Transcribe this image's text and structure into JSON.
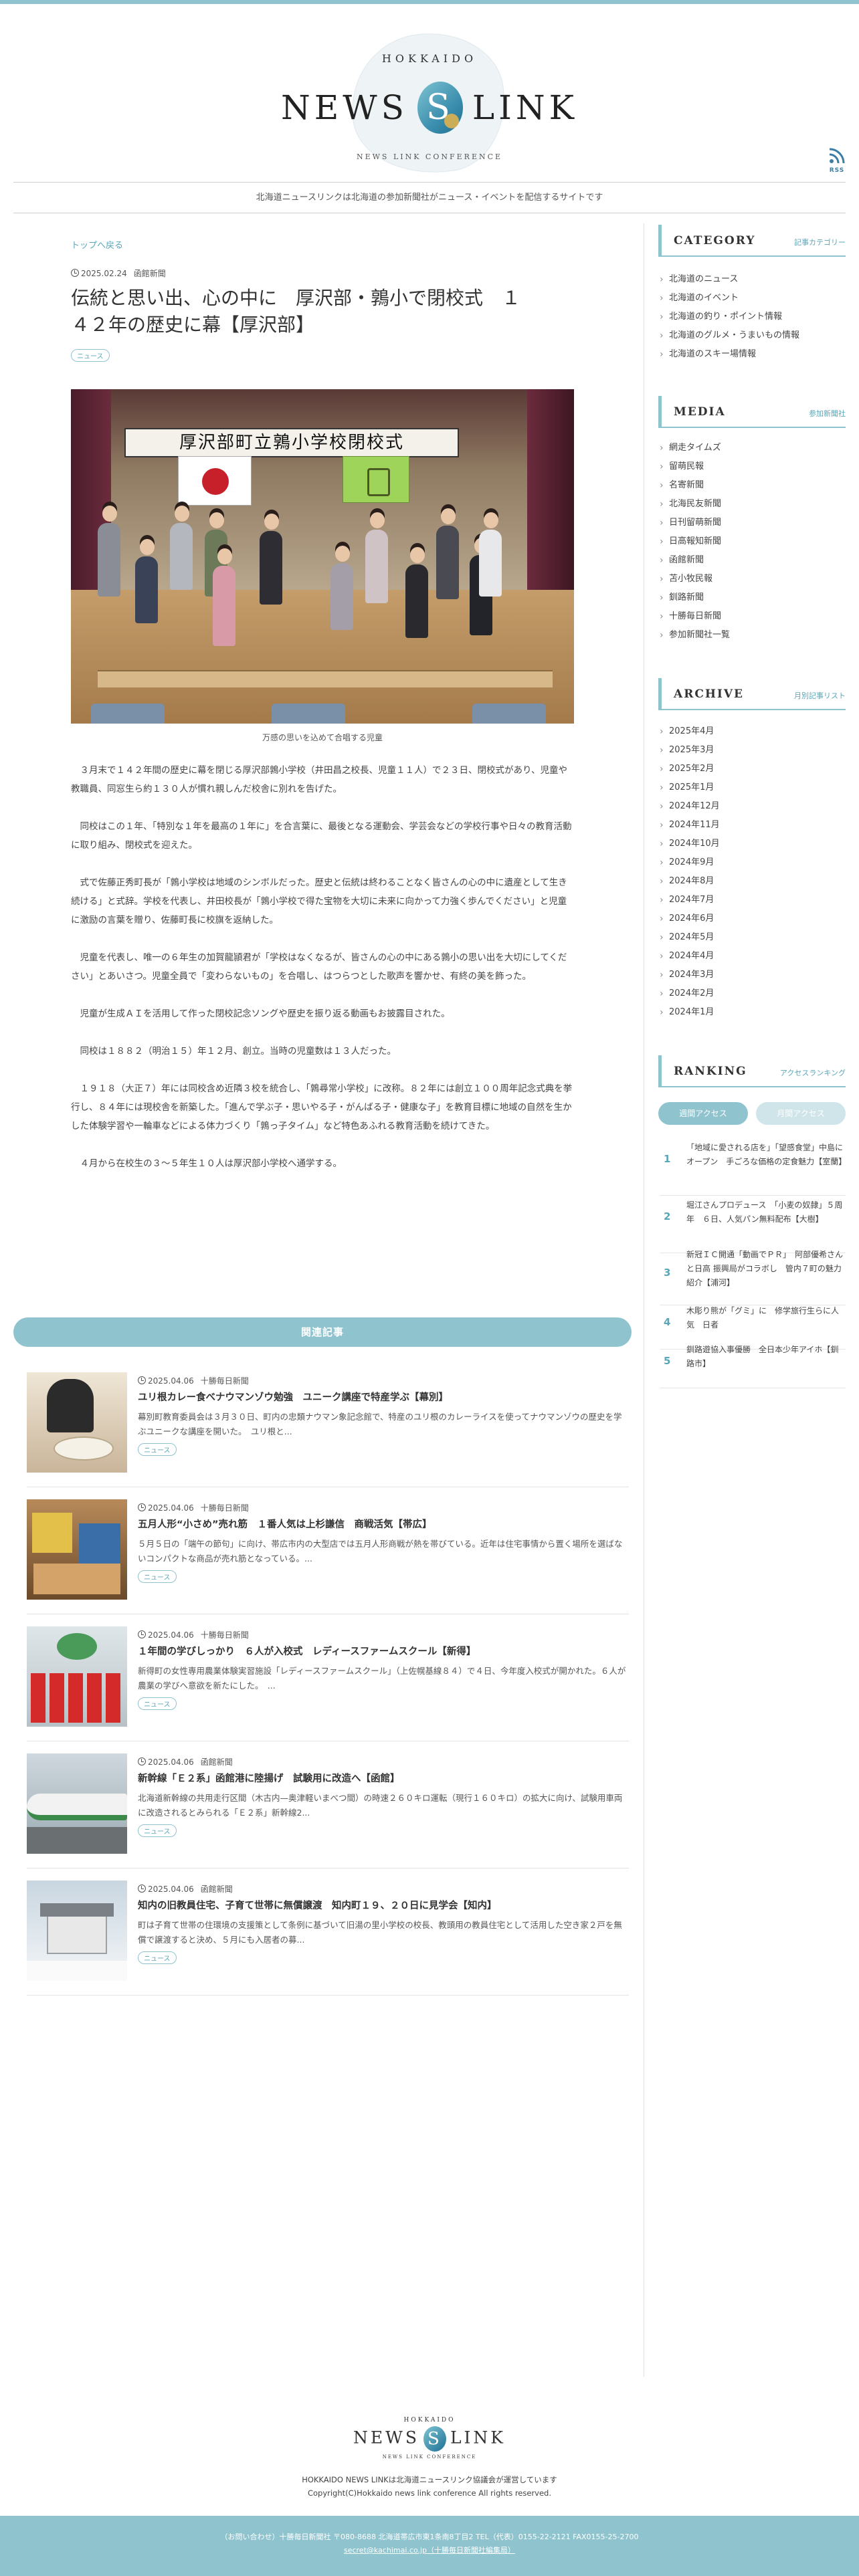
{
  "header": {
    "logo_top": "HOKKAIDO",
    "logo_left": "NEWS",
    "logo_s": "S",
    "logo_right": "LINK",
    "logo_sub": "NEWS LINK CONFERENCE",
    "rss_label": "RSS",
    "tagline": "北海道ニュースリンクは北海道の参加新聞社がニュース・イベントを配信するサイトです"
  },
  "article": {
    "back_link": "トップへ戻る",
    "date": "2025.02.24",
    "source": "函館新聞",
    "title": "伝統と思い出、心の中に　厚沢部・鶉小で閉校式　１４２年の歴史に幕【厚沢部】",
    "tag": "ニュース",
    "photo_banner": "厚沢部町立鶉小学校閉校式",
    "caption": "万感の思いを込めて合唱する児童",
    "paragraphs": [
      "３月末で１４２年間の歴史に幕を閉じる厚沢部鶉小学校（井田昌之校長、児童１１人）で２３日、閉校式があり、児童や教職員、同窓生ら約１３０人が慣れ親しんだ校舎に別れを告げた。",
      "同校はこの１年、「特別な１年を最高の１年に」を合言葉に、最後となる運動会、学芸会などの学校行事や日々の教育活動に取り組み、閉校式を迎えた。",
      "式で佐藤正秀町長が「鶉小学校は地域のシンボルだった。歴史と伝統は終わることなく皆さんの心の中に遺産として生き続ける」と式辞。学校を代表し、井田校長が「鶉小学校で得た宝物を大切に未来に向かって力強く歩んでください」と児童に激励の言葉を贈り、佐藤町長に校旗を返納した。",
      "児童を代表し、唯一の６年生の加賀龍頴君が「学校はなくなるが、皆さんの心の中にある鶉小の思い出を大切にしてください」とあいさつ。児童全員で「変わらないもの」を合唱し、はつらつとした歌声を響かせ、有終の美を飾った。",
      "児童が生成ＡＩを活用して作った閉校記念ソングや歴史を振り返る動画もお披露目された。",
      "同校は１８８２（明治１５）年１２月、創立。当時の児童数は１３人だった。",
      "１９１８（大正７）年には同校含め近隣３校を統合し、「鶉尋常小学校」に改称。８２年には創立１００周年記念式典を挙行し、８４年には現校舎を新築した。「進んで学ぶ子・思いやる子・がんばる子・健康な子」を教育目標に地域の自然を生かした体験学習や一輪車などによる体力づくり「鶉っ子タイム」など特色あふれる教育活動を続けてきた。",
      "４月から在校生の３〜５年生１０人は厚沢部小学校へ通学する。"
    ]
  },
  "related": {
    "heading": "関連記事",
    "items": [
      {
        "date": "2025.04.06",
        "source": "十勝毎日新聞",
        "title": "ユリ根カレー食べナウマンゾウ勉強　ユニーク講座で特産学ぶ【幕別】",
        "excerpt": "幕別町教育委員会は３月３０日、町内の忠類ナウマン象記念館で、特産のユリ根のカレーライスを使ってナウマンゾウの歴史を学ぶユニークな講座を開いた。　ユリ根と...",
        "tag": "ニュース"
      },
      {
        "date": "2025.04.06",
        "source": "十勝毎日新聞",
        "title": "五月人形“小さめ”売れ筋　１番人気は上杉謙信　商戦活気【帯広】",
        "excerpt": "５月５日の「端午の節句」に向け、帯広市内の大型店では五月人形商戦が熱を帯びている。近年は住宅事情から置く場所を選ばないコンパクトな商品が売れ筋となっている。...",
        "tag": "ニュース"
      },
      {
        "date": "2025.04.06",
        "source": "十勝毎日新聞",
        "title": "１年間の学びしっかり　６人が入校式　レディースファームスクール【新得】",
        "excerpt": "新得町の女性専用農業体験実習施設「レディースファームスクール」（上佐幌基線８４）で４日、今年度入校式が開かれた。６人が農業の学びへ意欲を新たにした。　...",
        "tag": "ニュース"
      },
      {
        "date": "2025.04.06",
        "source": "函館新聞",
        "title": "新幹線「Ｅ２系」函館港に陸揚げ　試験用に改造へ【函館】",
        "excerpt": "北海道新幹線の共用走行区間（木古内—奥津軽いまべつ間）の時速２６０キロ運転（現行１６０キロ）の拡大に向け、試験用車両に改造されるとみられる「Ｅ２系」新幹線2...",
        "tag": "ニュース"
      },
      {
        "date": "2025.04.06",
        "source": "函館新聞",
        "title": "知内の旧教員住宅、子育て世帯に無償譲渡　知内町１９、２０日に見学会【知内】",
        "excerpt": "町は子育て世帯の住環境の支援策として条例に基づいて旧湯の里小学校の校長、教頭用の教員住宅として活用した空き家２戸を無償で譲渡すると決め、５月にも入居者の募...",
        "tag": "ニュース"
      }
    ]
  },
  "sidebar": {
    "category": {
      "title": "CATEGORY",
      "sub": "記事カテゴリー",
      "items": [
        "北海道のニュース",
        "北海道のイベント",
        "北海道の釣り・ポイント情報",
        "北海道のグルメ・うまいもの情報",
        "北海道のスキー場情報"
      ]
    },
    "media": {
      "title": "MEDIA",
      "sub": "参加新聞社",
      "items": [
        "網走タイムズ",
        "留萌民報",
        "名寄新聞",
        "北海民友新聞",
        "日刊留萌新聞",
        "日高報知新聞",
        "函館新聞",
        "苫小牧民報",
        "釧路新聞",
        "十勝毎日新聞",
        "参加新聞社一覧"
      ]
    },
    "archive": {
      "title": "ARCHIVE",
      "sub": "月別記事リスト",
      "items": [
        "2025年4月",
        "2025年3月",
        "2025年2月",
        "2025年1月",
        "2024年12月",
        "2024年11月",
        "2024年10月",
        "2024年9月",
        "2024年8月",
        "2024年7月",
        "2024年6月",
        "2024年5月",
        "2024年4月",
        "2024年3月",
        "2024年2月",
        "2024年1月"
      ]
    },
    "ranking": {
      "title": "RANKING",
      "sub": "アクセスランキング",
      "tab_weekly": "週間アクセス",
      "tab_monthly": "月間アクセス",
      "items": [
        {
          "num": "1",
          "text": "「地域に愛される店を」「望感食堂」中島にオープン　手ごろな価格の定食魅力【室蘭】"
        },
        {
          "num": "2",
          "text": "堀江さんプロデュース　「小麦の奴隷」５周年　６日、人気パン無料配布【大樹】"
        },
        {
          "num": "3",
          "text": "新冠ＩＣ開通「動画でＰＲ」　阿部優希さんと日高 振興局がコラボし　管内７町の魅力紹介【浦河】"
        },
        {
          "num": "4",
          "text": "木彫り熊が「グミ」に　修学旅行生らに人気　日者"
        },
        {
          "num": "5",
          "text": "釧路遊協入事優勝　全日本少年アイホ【釧路市】"
        }
      ]
    }
  },
  "footer": {
    "logo_top": "HOKKAIDO",
    "logo_left": "NEWS",
    "logo_s": "S",
    "logo_right": "LINK",
    "logo_sub": "NEWS LINK CONFERENCE",
    "line1": "HOKKAIDO NEWS LINKは北海道ニュースリンク協議会が運営しています",
    "line2": "Copyright(C)Hokkaido news link conference All rights reserved.",
    "contact": "（お問い合わせ）十勝毎日新聞社 〒080-8688 北海道帯広市東1条南8丁目2 TEL（代表）0155-22-2121 FAX0155-25-2700",
    "email": "secret@kachimai.co.jp（十勝毎日新聞社編集局）"
  },
  "colors": {
    "accent": "#8fc3ce",
    "link": "#5aa6b8"
  }
}
